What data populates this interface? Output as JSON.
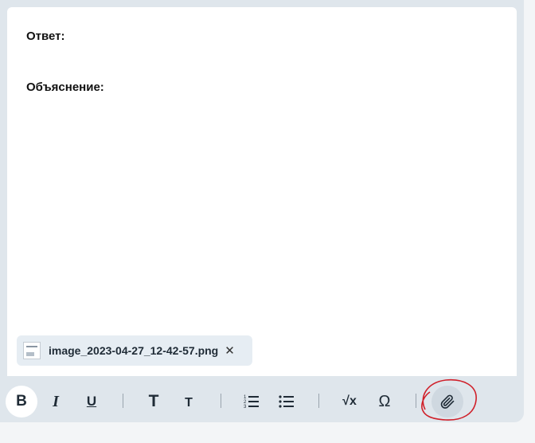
{
  "editor": {
    "answer_label": "Ответ:",
    "explanation_label": "Объяснение:"
  },
  "attachment": {
    "file_name": "image_2023-04-27_12-42-57.png",
    "remove_glyph": "✕"
  },
  "toolbar": {
    "bold": "B",
    "italic": "I",
    "underline": "U",
    "heading_large": "T",
    "heading_small": "T",
    "sqrt": "√x",
    "omega": "Ω",
    "icons": [
      "numbered-list-icon",
      "bulleted-list-icon",
      "paperclip-icon"
    ]
  },
  "colors": {
    "annotation": "#d0202a",
    "frame": "#dfe6ec"
  }
}
